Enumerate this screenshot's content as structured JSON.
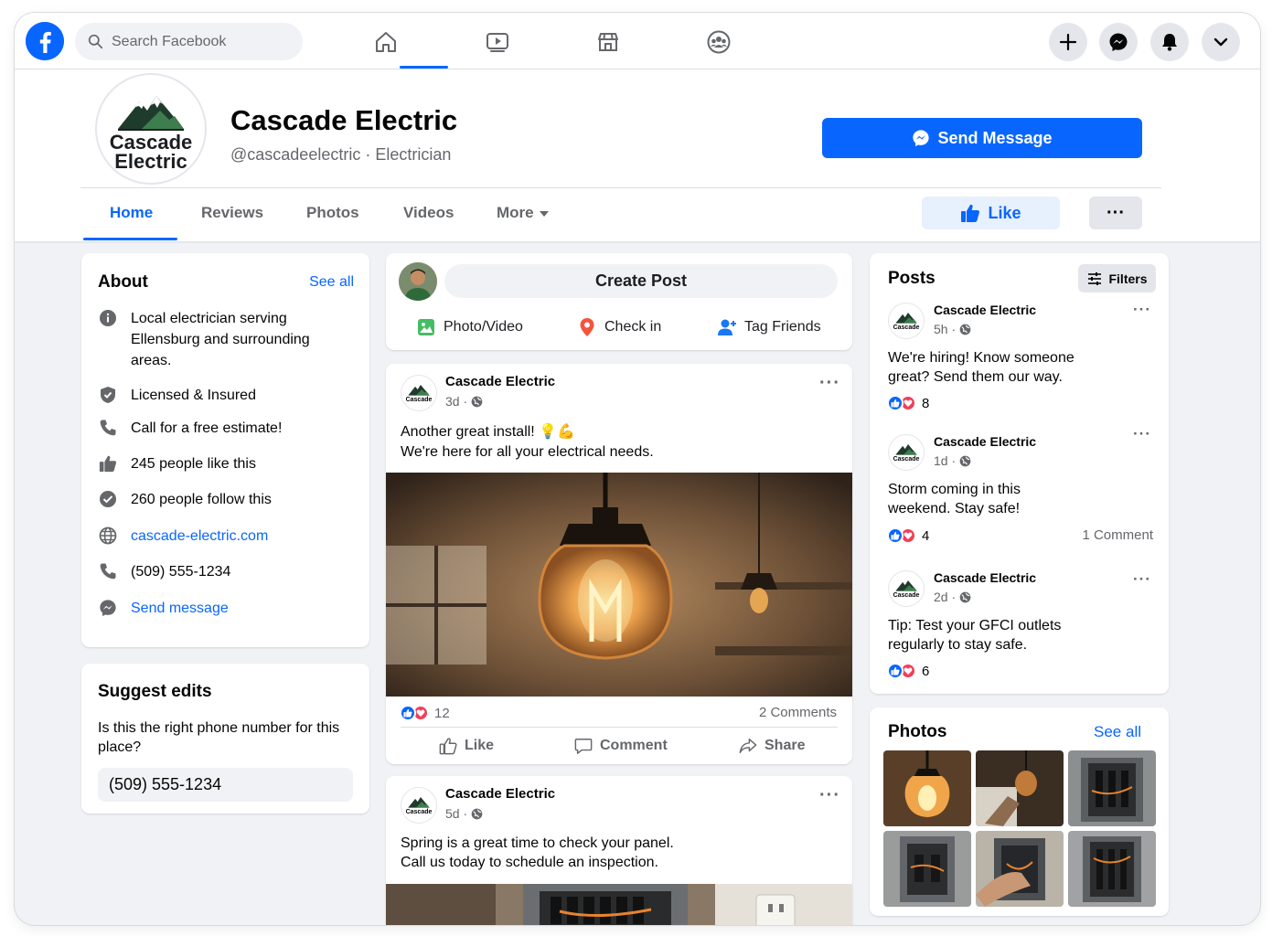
{
  "topbar": {
    "search_placeholder": "Search Facebook",
    "nav_icons": [
      "home-icon",
      "watch-icon",
      "marketplace-icon",
      "groups-icon"
    ],
    "right_icons": [
      "plus-icon",
      "messenger-icon",
      "bell-icon",
      "chevron-down-icon"
    ]
  },
  "page": {
    "logo_line1": "Cascade",
    "logo_line2": "Electric",
    "name": "Cascade Electric",
    "handle": "@cascadeelectric · Electrician",
    "send_message_label": "Send Message",
    "like_label": "Like",
    "more_label": "···"
  },
  "tabs": [
    {
      "label": "Home",
      "active": true
    },
    {
      "label": "Reviews"
    },
    {
      "label": "Photos"
    },
    {
      "label": "Videos"
    },
    {
      "label": "More"
    }
  ],
  "about": {
    "title": "About",
    "see_all": "See all",
    "items": [
      {
        "icon": "info-icon",
        "text": "Local electrician serving Ellensburg and surrounding areas."
      },
      {
        "icon": "shield-icon",
        "text": "Licensed & Insured"
      },
      {
        "icon": "phone-icon",
        "text": "Call for a free estimate!"
      },
      {
        "icon": "thumbs-up-icon",
        "text": "245 people like this"
      },
      {
        "icon": "check-circle-icon",
        "text": "260 people follow this"
      },
      {
        "icon": "globe-icon",
        "text": "cascade-electric.com"
      },
      {
        "icon": "phone-icon",
        "text": "(509) 555-1234"
      },
      {
        "icon": "messenger-icon",
        "text": "Send message"
      }
    ]
  },
  "suggest": {
    "title": "Suggest edits",
    "question": "Is this the right phone number for this place?",
    "value": "(509) 555-1234"
  },
  "composer": {
    "create_post": "Create Post",
    "photo_video": "Photo/Video",
    "check_in": "Check in",
    "tag_friends": "Tag Friends"
  },
  "feed": [
    {
      "author": "Cascade Electric",
      "time": "3d ·",
      "text_line1": "Another great install! 💡💪",
      "text_line2": "We're here for all your electrical needs.",
      "reactions": "12",
      "comments": "2 Comments",
      "actions": [
        "Like",
        "Comment",
        "Share"
      ]
    },
    {
      "author": "Cascade Electric",
      "time": "5d ·",
      "text_line1": "Spring is a great time to check your panel.",
      "text_line2": "Call us today to schedule an inspection."
    }
  ],
  "posts": {
    "title": "Posts",
    "filters": "Filters",
    "items": [
      {
        "author": "Cascade Electric",
        "time": "5h ·",
        "text": "We're hiring! Know someone great? Send them our way.",
        "reactions": "8",
        "comments": ""
      },
      {
        "author": "Cascade Electric",
        "time": "1d ·",
        "text": "Storm coming in this weekend. Stay safe!",
        "reactions": "4",
        "comments": "1 Comment"
      },
      {
        "author": "Cascade Electric",
        "time": "2d ·",
        "text": "Tip: Test your GFCI outlets regularly to stay safe.",
        "reactions": "6",
        "comments": ""
      }
    ]
  },
  "photos": {
    "title": "Photos",
    "see_all": "See all"
  },
  "colors": {
    "brand": "#0866ff",
    "love": "#f33e58",
    "background": "#f0f2f5"
  }
}
